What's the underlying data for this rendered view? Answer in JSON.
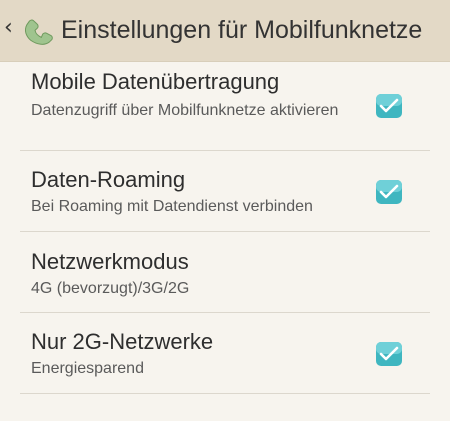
{
  "header": {
    "back_icon": "chevron-left-icon",
    "app_icon": "phone-handset-icon",
    "title": "Einstellungen für Mobilfunknetze"
  },
  "settings": [
    {
      "label": "Mobile Datenübertragung",
      "summary": "Datenzugriff über Mobilfunknetze aktivieren",
      "checked": true
    },
    {
      "label": "Daten-Roaming",
      "summary": "Bei Roaming mit Datendienst verbinden",
      "checked": true
    },
    {
      "label": "Netzwerkmodus",
      "summary": "4G (bevorzugt)/3G/2G"
    },
    {
      "label": "Nur 2G-Netzwerke",
      "summary": "Energiesparend",
      "checked": true
    }
  ],
  "colors": {
    "header_background": "#e3d9c6",
    "page_background": "#f7f4ee",
    "checkbox_accent": "#3fb6c0"
  }
}
